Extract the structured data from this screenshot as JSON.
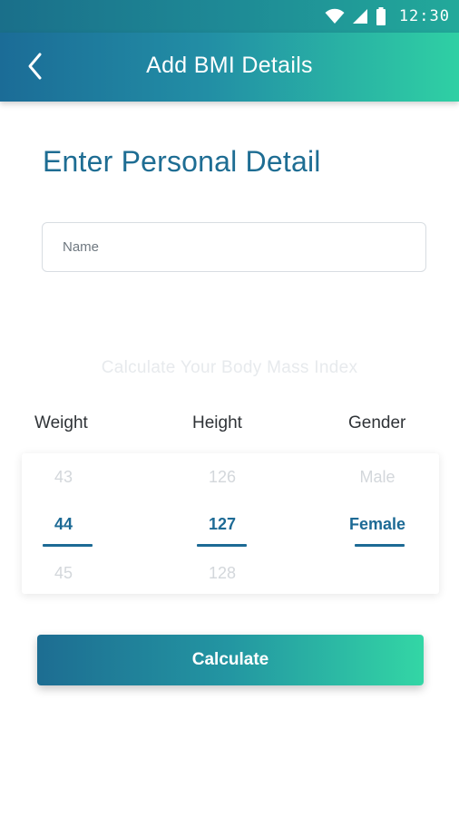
{
  "status_bar": {
    "time": "12:30",
    "icons": [
      "wifi-icon",
      "cell-signal-icon",
      "battery-icon"
    ]
  },
  "app_bar": {
    "back_icon": "chevron-left-icon",
    "title": "Add BMI Details"
  },
  "form": {
    "section_title": "Enter Personal Detail",
    "name_placeholder": "Name",
    "name_value": ""
  },
  "bmi": {
    "subtitle": "Calculate Your Body Mass Index",
    "weight": {
      "label": "Weight",
      "prev": "43",
      "selected": "44",
      "next": "45"
    },
    "height": {
      "label": "Height",
      "prev": "126",
      "selected": "127",
      "next": "128"
    },
    "gender": {
      "label": "Gender",
      "prev": "Male",
      "selected": "Female",
      "next": ""
    }
  },
  "actions": {
    "calculate_label": "Calculate"
  },
  "colors": {
    "primary": "#1d6a95",
    "accent": "#33d6a5",
    "text_dark": "#2f3337"
  }
}
